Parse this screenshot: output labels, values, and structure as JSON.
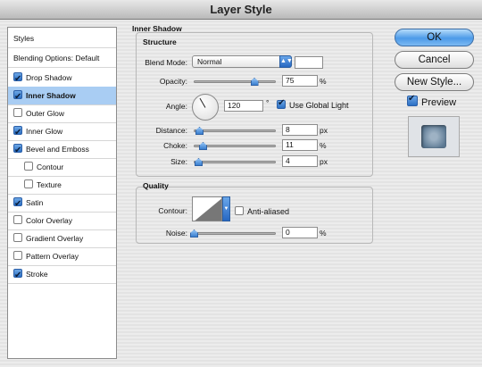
{
  "window": {
    "title": "Layer Style"
  },
  "sidebar": {
    "header": "Styles",
    "blending_options": "Blending Options: Default",
    "items": [
      {
        "label": "Drop Shadow",
        "checked": true,
        "selected": false,
        "indent": false
      },
      {
        "label": "Inner Shadow",
        "checked": true,
        "selected": true,
        "indent": false
      },
      {
        "label": "Outer Glow",
        "checked": false,
        "selected": false,
        "indent": false
      },
      {
        "label": "Inner Glow",
        "checked": true,
        "selected": false,
        "indent": false
      },
      {
        "label": "Bevel and Emboss",
        "checked": true,
        "selected": false,
        "indent": false
      },
      {
        "label": "Contour",
        "checked": false,
        "selected": false,
        "indent": true
      },
      {
        "label": "Texture",
        "checked": false,
        "selected": false,
        "indent": true
      },
      {
        "label": "Satin",
        "checked": true,
        "selected": false,
        "indent": false
      },
      {
        "label": "Color Overlay",
        "checked": false,
        "selected": false,
        "indent": false
      },
      {
        "label": "Gradient Overlay",
        "checked": false,
        "selected": false,
        "indent": false
      },
      {
        "label": "Pattern Overlay",
        "checked": false,
        "selected": false,
        "indent": false
      },
      {
        "label": "Stroke",
        "checked": true,
        "selected": false,
        "indent": false
      }
    ]
  },
  "panel": {
    "title": "Inner Shadow",
    "structure": {
      "title": "Structure",
      "blend_mode_label": "Blend Mode:",
      "blend_mode_value": "Normal",
      "opacity_label": "Opacity:",
      "opacity_value": "75",
      "opacity_unit": "%",
      "opacity_level": 0.75,
      "angle_label": "Angle:",
      "angle_value": "120",
      "angle_unit": "°",
      "use_global_light_label": "Use Global Light",
      "use_global_light_checked": true,
      "distance_label": "Distance:",
      "distance_value": "8",
      "distance_unit": "px",
      "choke_label": "Choke:",
      "choke_value": "11",
      "choke_unit": "%",
      "size_label": "Size:",
      "size_value": "4",
      "size_unit": "px"
    },
    "quality": {
      "title": "Quality",
      "contour_label": "Contour:",
      "anti_aliased_label": "Anti-aliased",
      "anti_aliased_checked": false,
      "noise_label": "Noise:",
      "noise_value": "0",
      "noise_unit": "%"
    }
  },
  "buttons": {
    "ok": "OK",
    "cancel": "Cancel",
    "new_style": "New Style..."
  },
  "preview": {
    "label": "Preview",
    "checked": true
  },
  "colors": {
    "accent": "#3a7fd0",
    "selection": "#a9cdf3"
  }
}
